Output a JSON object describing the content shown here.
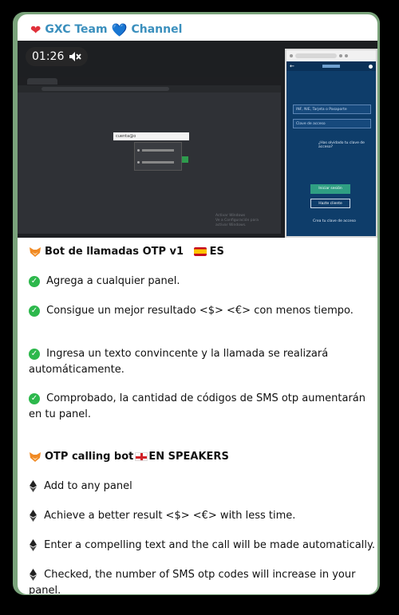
{
  "channel": {
    "name": "GXC Team",
    "suffix": "Channel"
  },
  "video": {
    "time": "01:26",
    "desktop": {
      "search_text": "cuenta@o",
      "watermark": "Activar Windows\nVe a Configuración para activar Windows."
    },
    "phone": {
      "input1": "INF, NIE, Tarjeta o Pasaporte",
      "input2": "Clave de acceso",
      "forgot": "¿Has olvidado tu clave de acceso?",
      "login_button": "Iniciar sesión",
      "client_button": "Hazte cliente",
      "create_key": "Crea tu clave de acceso"
    }
  },
  "message": {
    "es_title": "Bot de llamadas  OTP v1",
    "es_lang": "ES",
    "es_items": [
      "Agrega  a cualquier panel.",
      "Consigue un mejor resultado <$> <€> con menos tiempo.",
      "Ingresa un texto convincente y la llamada se realizará automáticamente.",
      "Comprobado, la cantidad de códigos de SMS otp aumentarán en tu panel."
    ],
    "en_title": "OTP calling bot",
    "en_lang": "EN SPEAKERS",
    "en_items": [
      "Add to any panel",
      "Achieve a better result <$> <€> with less time.",
      "Enter a compelling text and the call will be made automatically.",
      "Checked, the number of SMS otp codes will increase in your panel."
    ]
  }
}
